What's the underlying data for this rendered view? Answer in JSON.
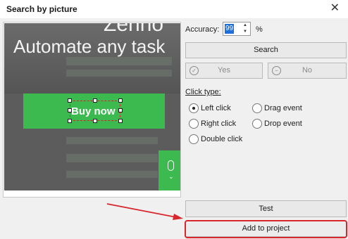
{
  "window": {
    "title": "Search by picture",
    "close_glyph": "✕"
  },
  "preview": {
    "brand_text": "Zenno",
    "headline": "Automate any task",
    "cta_label": "Buy now"
  },
  "accuracy": {
    "label": "Accuracy:",
    "value": "99",
    "unit": "%"
  },
  "buttons": {
    "search": "Search",
    "yes": "Yes",
    "no": "No",
    "test": "Test",
    "add_to_project": "Add to project"
  },
  "click_type": {
    "label": "Click type:",
    "options": [
      "Left click",
      "Drag event",
      "Right click",
      "Drop event",
      "Double click"
    ],
    "selected": "Left click"
  },
  "colors": {
    "accent_green": "#3cb94f",
    "annotation_red": "#d9262c",
    "selection_blue": "#1e6fd9"
  }
}
